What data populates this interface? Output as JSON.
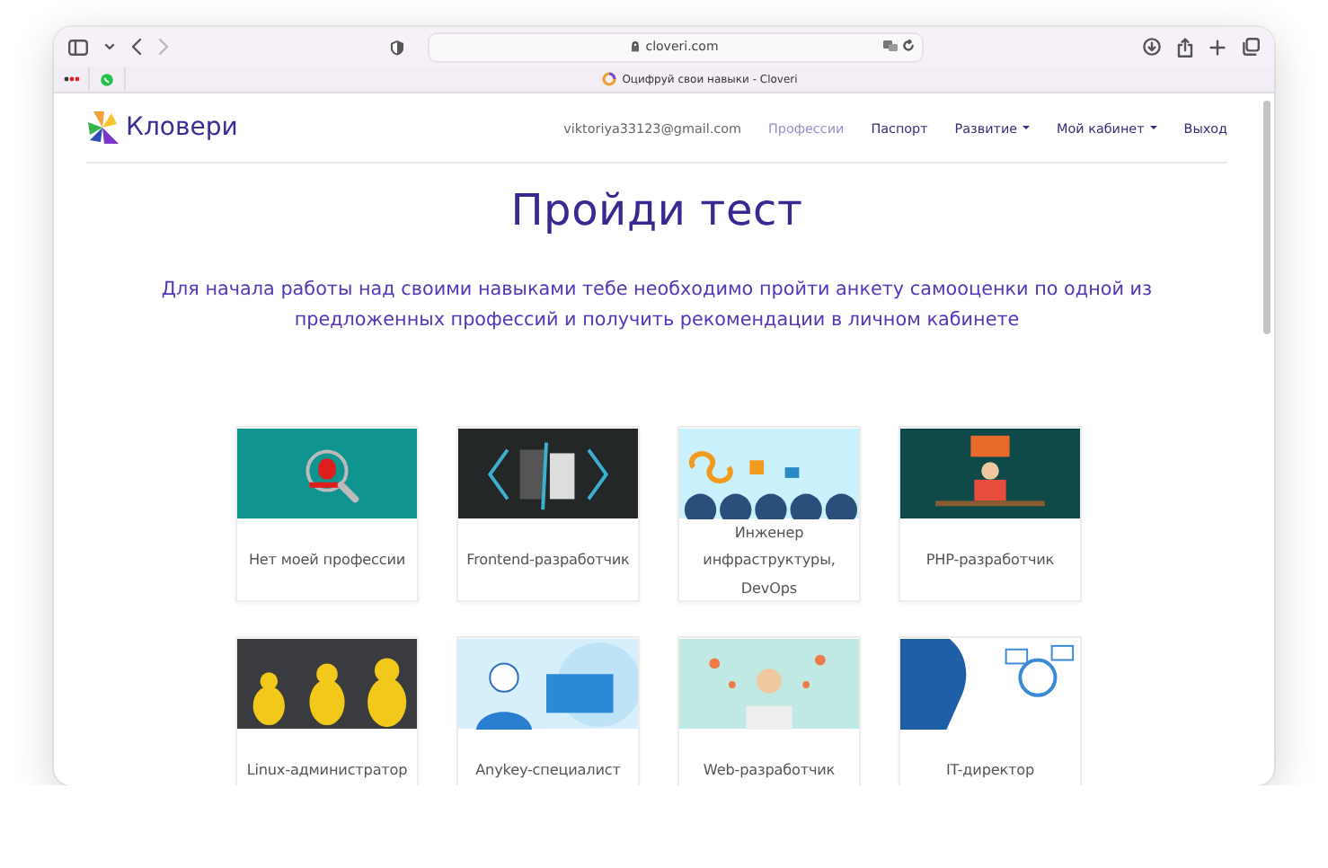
{
  "browser": {
    "address": "cloveri.com",
    "tab_title": "Оцифруй свои навыки - Cloveri"
  },
  "site": {
    "logo": "Кловери",
    "nav": [
      {
        "label": "viktoriya33123@gmail.com",
        "kind": "email",
        "selected": false,
        "dropdown": false
      },
      {
        "label": "Профессии",
        "kind": "link",
        "selected": true,
        "dropdown": false
      },
      {
        "label": "Паспорт",
        "kind": "link",
        "selected": false,
        "dropdown": false
      },
      {
        "label": "Развитие",
        "kind": "link",
        "selected": false,
        "dropdown": true
      },
      {
        "label": "Мой кабинет",
        "kind": "link",
        "selected": false,
        "dropdown": true
      },
      {
        "label": "Выход",
        "kind": "link",
        "selected": false,
        "dropdown": false
      }
    ]
  },
  "title": "Пройди тест",
  "intro": "Для начала работы над своими навыками тебе необходимо пройти анкету самооценки по одной из предложенных профессий и получить рекомендации в личном кабинете",
  "professions": [
    {
      "name": "Нет моей профессии"
    },
    {
      "name": "Frontend-разработчик"
    },
    {
      "name": "Инженер инфраструктуры, DevOps"
    },
    {
      "name": "PHP-разработчик"
    },
    {
      "name": "Linux-администратор"
    },
    {
      "name": "Anykey-специалист"
    },
    {
      "name": "Web-разработчик"
    },
    {
      "name": "IT-директор"
    }
  ]
}
